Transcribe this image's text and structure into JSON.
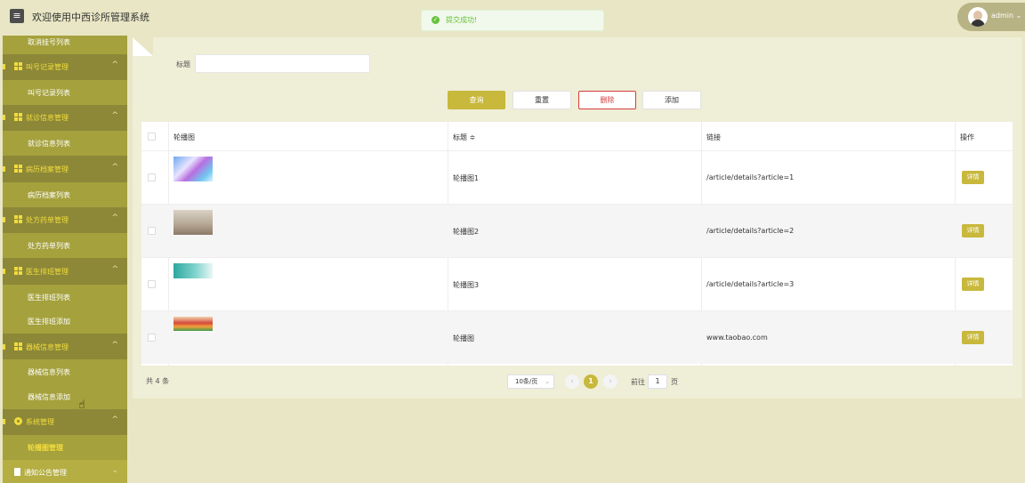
{
  "header": {
    "title": "欢迎使用中西诊所管理系统",
    "menu_icon": "hamburger-icon",
    "toast": "提交成功!",
    "user": "admin"
  },
  "sidebar": {
    "items": [
      {
        "type": "sub",
        "label": "取消挂号列表"
      },
      {
        "type": "group",
        "label": "叫号记录管理",
        "icon": "grid-icon"
      },
      {
        "type": "sub",
        "label": "叫号记录列表"
      },
      {
        "type": "group",
        "label": "就诊信息管理",
        "icon": "grid-icon"
      },
      {
        "type": "sub",
        "label": "就诊信息列表"
      },
      {
        "type": "group",
        "label": "病历档案管理",
        "icon": "grid-icon"
      },
      {
        "type": "sub",
        "label": "病历档案列表"
      },
      {
        "type": "group",
        "label": "处方药单管理",
        "icon": "grid-icon"
      },
      {
        "type": "sub",
        "label": "处方药单列表"
      },
      {
        "type": "group",
        "label": "医生排班管理",
        "icon": "grid-icon"
      },
      {
        "type": "sub",
        "label": "医生排班列表"
      },
      {
        "type": "sub",
        "label": "医生排班添加"
      },
      {
        "type": "group",
        "label": "器械信息管理",
        "icon": "grid-icon"
      },
      {
        "type": "sub",
        "label": "器械信息列表"
      },
      {
        "type": "sub",
        "label": "器械信息添加"
      },
      {
        "type": "group",
        "label": "系统管理",
        "icon": "gear-icon"
      },
      {
        "type": "active",
        "label": "轮播图管理"
      },
      {
        "type": "next",
        "label": "通知公告管理",
        "icon": "document-icon"
      }
    ]
  },
  "search": {
    "label": "标题",
    "value": "",
    "placeholder": ""
  },
  "actions": {
    "query": "查询",
    "reset": "重置",
    "delete": "删除",
    "add": "添加"
  },
  "table": {
    "headers": {
      "image": "轮播图",
      "title": "标题 ≑",
      "link": "链接",
      "ops": "操作"
    },
    "detail_label": "详情",
    "rows": [
      {
        "title": "轮播图1",
        "link": "/article/details?article=1"
      },
      {
        "title": "轮播图2",
        "link": "/article/details?article=2"
      },
      {
        "title": "轮播图3",
        "link": "/article/details?article=3"
      },
      {
        "title": "轮播图",
        "link": "www.taobao.com"
      }
    ]
  },
  "pagination": {
    "total": "共 4 条",
    "page_size": "10条/页",
    "current": "1",
    "goto_prefix": "前往",
    "goto_value": "1",
    "goto_suffix": "页"
  },
  "colors": {
    "accent": "#c8b83c",
    "sidebar": "#8c8838",
    "danger": "#d43c3c"
  }
}
